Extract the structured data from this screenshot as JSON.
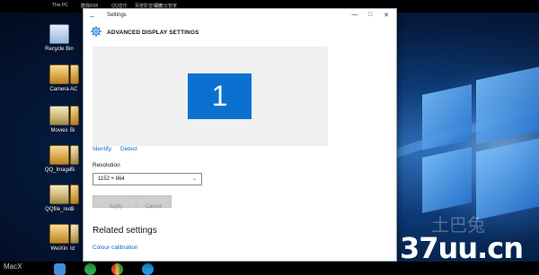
{
  "desktop": {
    "top_labels": [
      "This PC",
      "酷我RMI",
      "QQ音乐",
      "百度影音播放",
      "百度云管家"
    ],
    "icons": [
      {
        "label": "Recycle Bin",
        "icon": "recycle-bin-icon"
      },
      {
        "label": "Camera",
        "icon": "folder-icon"
      },
      {
        "label": "Movies",
        "icon": "folder-icon"
      },
      {
        "label": "QQ_Images",
        "icon": "folder-icon"
      },
      {
        "label": "QQfile_recv",
        "icon": "folder-icon"
      },
      {
        "label": "WeiXin",
        "icon": "folder-icon"
      }
    ],
    "partial_labels": [
      "AC",
      "Bi",
      "Fi",
      "G",
      "Id"
    ]
  },
  "taskbar": {
    "label": "MacX"
  },
  "watermark": {
    "cn": "土巴兔",
    "url": "37uu.cn"
  },
  "window": {
    "title": "Settings",
    "controls": {
      "minimize": "—",
      "maximize": "□",
      "close": "✕"
    },
    "back_icon": "←",
    "page_title": "ADVANCED DISPLAY SETTINGS",
    "monitor_number": "1",
    "links": {
      "identify": "Identify",
      "detect": "Detect"
    },
    "resolution": {
      "label": "Resolution",
      "value": "1152 × 864",
      "chevron": "⌄"
    },
    "buttons": {
      "apply": "Apply",
      "cancel": "Cancel"
    },
    "related": {
      "heading": "Related settings",
      "link": "Colour calibration"
    }
  },
  "colors": {
    "accent": "#0a71d0",
    "link": "#0a6ad0"
  }
}
